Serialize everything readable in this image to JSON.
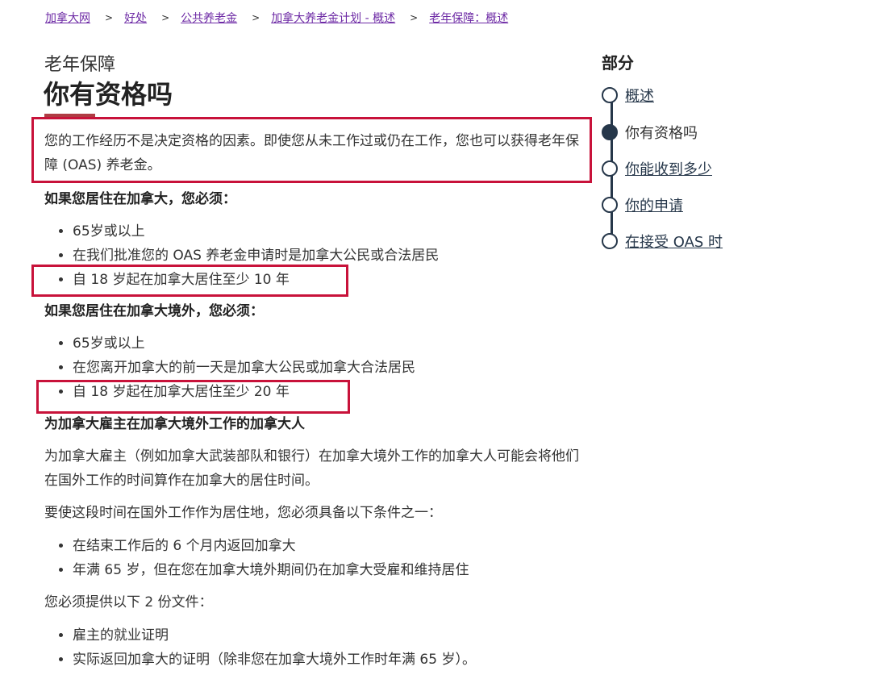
{
  "breadcrumb": [
    "加拿大网",
    "好处",
    "公共养老金",
    "加拿大养老金计划 - 概述",
    "老年保障：概述"
  ],
  "breadcrumb_separator": ">",
  "subtitle": "老年保障",
  "title": "你有资格吗",
  "intro": "您的工作经历不是决定资格的因素。即使您从未工作过或仍在工作，您也可以获得老年保障 (OAS) 养老金。",
  "inside": {
    "heading": "如果您居住在加拿大，您必须：",
    "items": [
      "65岁或以上",
      "在我们批准您的 OAS 养老金申请时是加拿大公民或合法居民",
      "自 18 岁起在加拿大居住至少 10 年"
    ]
  },
  "outside": {
    "heading": "如果您居住在加拿大境外，您必须：",
    "items": [
      "65岁或以上",
      "在您离开加拿大的前一天是加拿大公民或加拿大合法居民",
      "自 18 岁起在加拿大居住至少 20 年"
    ]
  },
  "employer": {
    "heading": "为加拿大雇主在加拿大境外工作的加拿大人",
    "para1": "为加拿大雇主（例如加拿大武装部队和银行）在加拿大境外工作的加拿大人可能会将他们在国外工作的时间算作在加拿大的居住时间。",
    "para2": "要使这段时间在国外工作作为居住地，您必须具备以下条件之一：",
    "conditions": [
      "在结束工作后的 6 个月内返回加拿大",
      "年满 65 岁，但在您在加拿大境外期间仍在加拿大受雇和维持居住"
    ],
    "para3": "您必须提供以下 2 份文件：",
    "documents": [
      "雇主的就业证明",
      "实际返回加拿大的证明（除非您在加拿大境外工作时年满 65 岁）。"
    ]
  },
  "sidebar": {
    "title": "部分",
    "items": [
      {
        "label": "概述",
        "current": false
      },
      {
        "label": "你有资格吗",
        "current": true
      },
      {
        "label": "你能收到多少",
        "current": false
      },
      {
        "label": "你的申请",
        "current": false
      },
      {
        "label": "在接受 OAS 时",
        "current": false
      }
    ]
  },
  "colors": {
    "link": "#6d2aa5",
    "highlight": "#c8123a",
    "nav": "#26374a",
    "title_bar": "#af3c43"
  }
}
